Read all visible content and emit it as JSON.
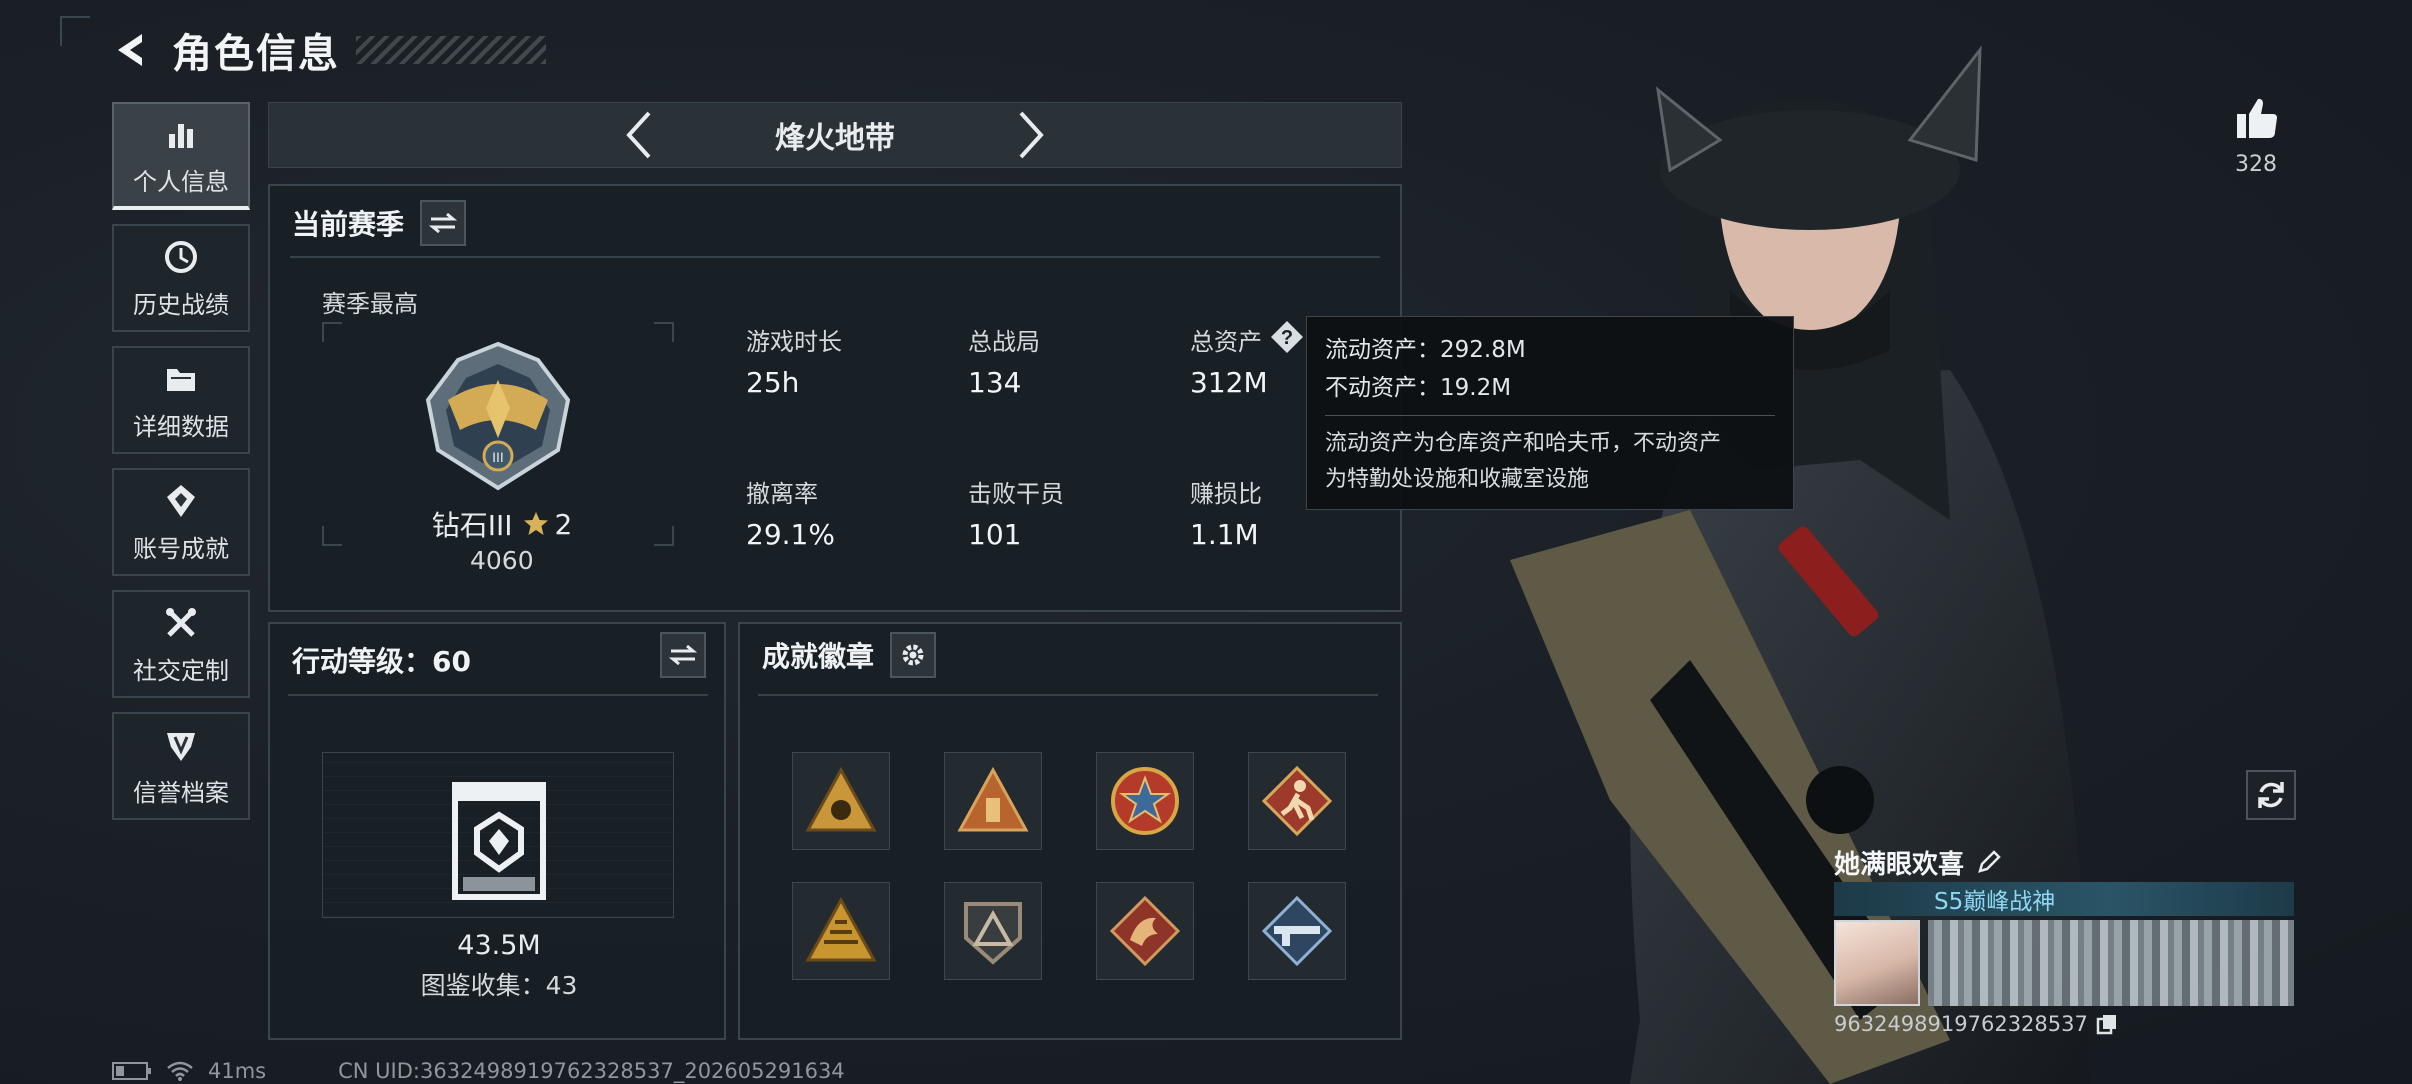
{
  "header": {
    "title": "角色信息"
  },
  "sidebar": {
    "items": [
      {
        "label": "个人信息",
        "icon": "bar-chart-icon",
        "active": true
      },
      {
        "label": "历史战绩",
        "icon": "history-icon"
      },
      {
        "label": "详细数据",
        "icon": "folder-icon"
      },
      {
        "label": "账号成就",
        "icon": "achievement-icon"
      },
      {
        "label": "社交定制",
        "icon": "tools-icon"
      },
      {
        "label": "信誉档案",
        "icon": "credit-icon"
      }
    ]
  },
  "mode": {
    "label": "烽火地带"
  },
  "season": {
    "title": "当前赛季",
    "best_label": "赛季最高",
    "rank_name": "钻石III",
    "rank_stars": "2",
    "rank_score": "4060",
    "stats": [
      {
        "label": "游戏时长",
        "value": "25h"
      },
      {
        "label": "总战局",
        "value": "134"
      },
      {
        "label": "总资产",
        "value": "312M"
      },
      {
        "label": "撤离率",
        "value": "29.1%"
      },
      {
        "label": "击败干员",
        "value": "101"
      },
      {
        "label": "赚损比",
        "value": "1.1M"
      }
    ]
  },
  "tooltip": {
    "liquid": "流动资产：292.8M",
    "fixed": "不动资产：19.2M",
    "desc_1": "流动资产为仓库资产和哈夫币，不动资产",
    "desc_2": "为特勤处设施和收藏室设施"
  },
  "level": {
    "title": "行动等级：60",
    "value": "43.5M",
    "collection": "图鉴收集：43"
  },
  "achievements": {
    "title": "成就徽章",
    "badges": [
      {
        "icon": "triangle-emblem-icon",
        "color": "#c9963a"
      },
      {
        "icon": "triangle-tower-icon",
        "color": "#b8642e"
      },
      {
        "icon": "star-shield-icon",
        "color": "#b43a2a"
      },
      {
        "icon": "runner-icon",
        "color": "#9c3a2c"
      },
      {
        "icon": "pyramid-icon",
        "color": "#c8962f"
      },
      {
        "icon": "shield-triangle-icon",
        "color": "#9a8a78"
      },
      {
        "icon": "dragon-icon",
        "color": "#8e3429"
      },
      {
        "icon": "rifle-icon",
        "color": "#4d6d8e"
      }
    ]
  },
  "likes": {
    "count": "328"
  },
  "player": {
    "name": "她满眼欢喜",
    "rank": "S5巅峰战神",
    "uid": "9632498919762328537"
  },
  "status": {
    "ping": "41ms",
    "uid_line": "CN UID:3632498919762328537_202605291634"
  }
}
